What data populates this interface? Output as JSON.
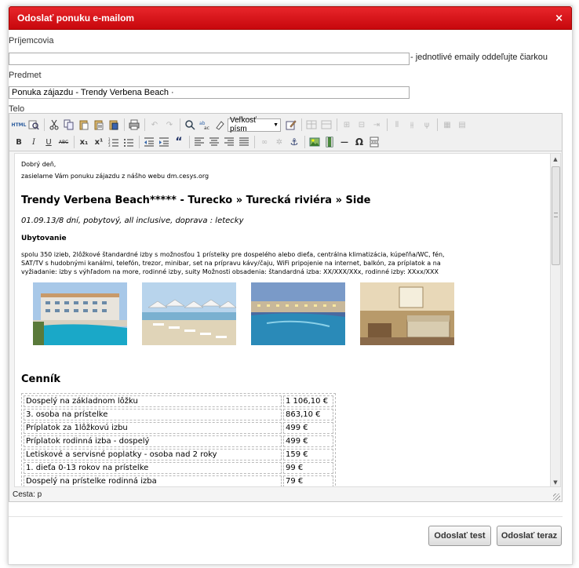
{
  "dialog": {
    "title": "Odoslať ponuku e-mailom",
    "close_glyph": "×"
  },
  "form": {
    "recipients_label": "Príjemcovia",
    "recipients_value": "",
    "recipients_hint": "- jednotlivé emaily oddeľujte čiarkou",
    "subject_label": "Predmet",
    "subject_value": "Ponuka zájazdu - Trendy Verbena Beach ·",
    "body_label": "Telo"
  },
  "toolbar": {
    "font_size_select": "Veľkosť písm",
    "row1_icons": [
      "html-source-icon",
      "find-icon",
      "cut-icon",
      "copy-icon",
      "paste-icon",
      "paste-text-icon",
      "paste-word-icon",
      "print-icon",
      "undo-icon",
      "redo-icon",
      "search-icon",
      "replace-icon",
      "clean-icon"
    ],
    "row2_icons": [
      "bold-icon",
      "italic-icon",
      "underline-icon",
      "strikethrough-icon",
      "subscript-icon",
      "superscript-icon",
      "ordered-list-icon",
      "unordered-list-icon",
      "outdent-icon",
      "indent-icon",
      "blockquote-icon",
      "align-left-icon",
      "align-center-icon",
      "align-right-icon",
      "align-justify-icon",
      "link-icon",
      "unlink-icon",
      "anchor-icon",
      "image-icon",
      "media-icon",
      "horizontal-rule-icon",
      "special-char-icon",
      "page-break-icon"
    ],
    "glyphs": {
      "html": "HTML",
      "bold": "B",
      "italic": "I",
      "underline": "U",
      "strike": "ABC",
      "sub": "x₁",
      "sup": "x¹",
      "omega": "Ω",
      "hr": "—",
      "quote": "“"
    }
  },
  "content": {
    "greeting": "Dobrý deň,",
    "intro": "zasielame Vám ponuku zájazdu z nášho webu dm.cesys.org",
    "hotel_title": "Trendy Verbena Beach***** - Turecko » Turecká riviéra » Side",
    "trip_info": "01.09.13/8 dní, pobytový, all inclusive, doprava : letecky",
    "accommodation_heading": "Ubytovanie",
    "accommodation_text": "spolu 350 izieb, 2lôžkové štandardné izby s možnosťou 1 prístelky pre dospelého alebo dieťa, centrálna klimatizácia, kúpeľňa/WC, fén, SAT/TV s hudobnými kanálmi, telefón, trezor, minibar, set na prípravu kávy/čaju, WiFi pripojenie na internet, balkón, za príplatok a na vyžiadanie: izby s výhľadom na more, rodinné izby, suity Možnosti obsadenia: štandardná izba: XX/XXX/XXx, rodinné izby: XXxx/XXX",
    "price_heading": "Cenník",
    "prices": [
      {
        "name": "Dospelý na základnom lôžku",
        "value": "1 106,10 €"
      },
      {
        "name": "3. osoba na prístelke",
        "value": "863,10 €"
      },
      {
        "name": "Príplatok za 1lôžkovú izbu",
        "value": "499 €"
      },
      {
        "name": "Príplatok rodinná izba - dospelý",
        "value": "499 €"
      },
      {
        "name": "Letiskové a servisné poplatky - osoba nad 2 roky",
        "value": "159 €"
      },
      {
        "name": "1. dieťa 0-13 rokov na prístelke",
        "value": "99 €"
      },
      {
        "name": "Dospelý na prístelke rodinná izba",
        "value": "79 €"
      }
    ]
  },
  "statusbar": {
    "path": "Cesta: p"
  },
  "buttons": {
    "send_test": "Odoslať test",
    "send_now": "Odoslať teraz"
  }
}
